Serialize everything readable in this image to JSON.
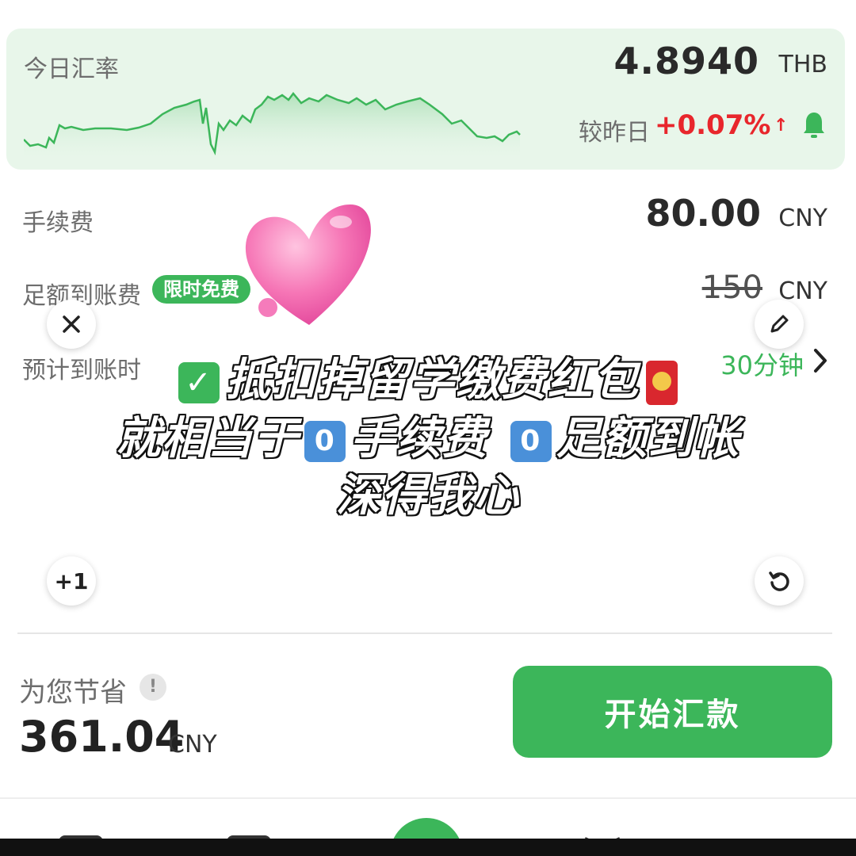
{
  "rate_card": {
    "label": "今日汇率",
    "value": "4.8940",
    "unit": "THB",
    "change_label": "较昨日",
    "change_value": "+0.07%",
    "change_arrow": "↑",
    "bell_icon": "bell-icon",
    "accent_color": "#3cb65a",
    "change_color": "#e8262c"
  },
  "fee": {
    "label": "手续费",
    "value": "80.00",
    "unit": "CNY"
  },
  "full_amount": {
    "label": "足额到账费",
    "badge": "限时免费",
    "original_value": "150",
    "unit": "CNY"
  },
  "eta": {
    "label": "预计到账时",
    "value": "30分钟"
  },
  "overlay_caption": {
    "line1": "抵扣掉留学缴费红包",
    "line2_a": "就相当于",
    "line2_b": "手续费",
    "line2_c": "足额到帐",
    "line3": "深得我心",
    "check_glyph": "✓",
    "zero_glyph": "0"
  },
  "floating_buttons": {
    "close_icon": "close-icon",
    "edit_icon": "pencil-icon",
    "plus_one": "+1",
    "undo_icon": "undo-icon"
  },
  "savings": {
    "label": "为您节省",
    "info_glyph": "!",
    "amount": "361.04",
    "unit": "CNY"
  },
  "primary_button": {
    "label": "开始汇款"
  }
}
